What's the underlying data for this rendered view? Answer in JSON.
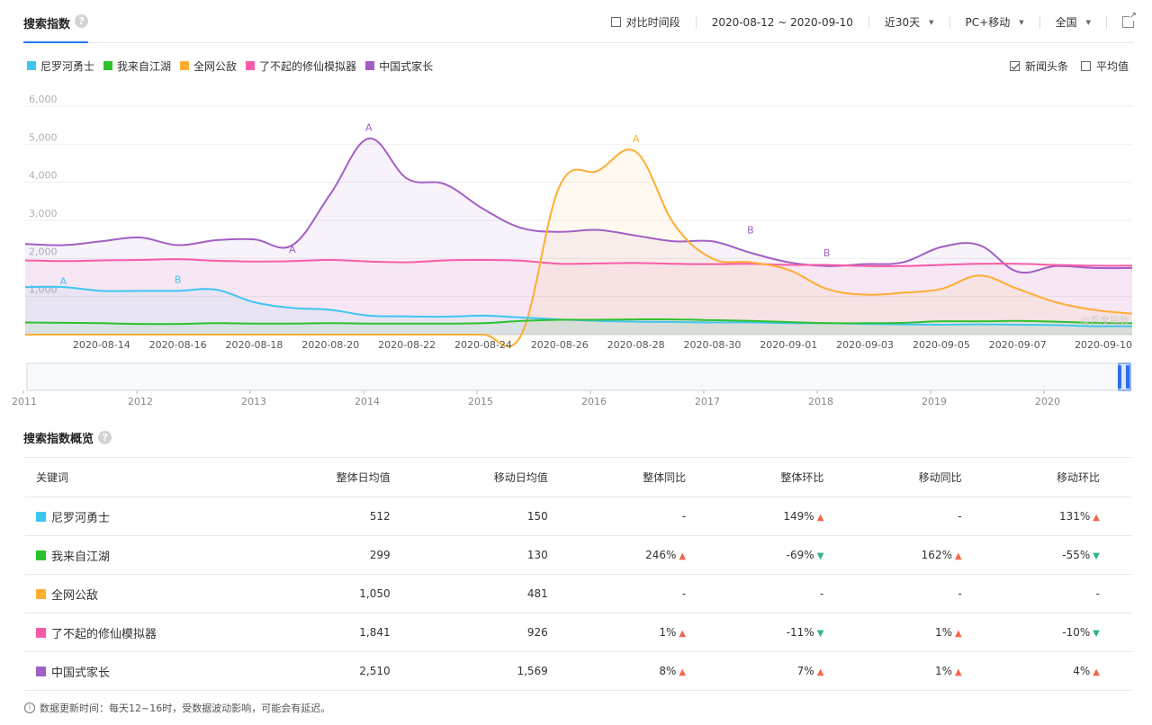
{
  "header": {
    "title": "搜索指数",
    "compare_label": "对比时间段",
    "date_range": "2020-08-12 ~ 2020-09-10",
    "period": "近30天",
    "device": "PC+移动",
    "region": "全国"
  },
  "legend_options": {
    "news_label": "新闻头条",
    "avg_label": "平均值"
  },
  "chart_data": {
    "type": "area",
    "ylim": [
      0,
      6000
    ],
    "yticks": [
      "6,000",
      "5,000",
      "4,000",
      "3,000",
      "2,000",
      "1,000"
    ],
    "x": [
      "2020-08-12",
      "2020-08-13",
      "2020-08-14",
      "2020-08-15",
      "2020-08-16",
      "2020-08-17",
      "2020-08-18",
      "2020-08-19",
      "2020-08-20",
      "2020-08-21",
      "2020-08-22",
      "2020-08-23",
      "2020-08-24",
      "2020-08-25",
      "2020-08-26",
      "2020-08-27",
      "2020-08-28",
      "2020-08-29",
      "2020-08-30",
      "2020-08-31",
      "2020-09-01",
      "2020-09-02",
      "2020-09-03",
      "2020-09-04",
      "2020-09-05",
      "2020-09-06",
      "2020-09-07",
      "2020-09-08",
      "2020-09-09",
      "2020-09-10"
    ],
    "xtick_labels": [
      "2020-08-14",
      "2020-08-16",
      "2020-08-18",
      "2020-08-20",
      "2020-08-22",
      "2020-08-24",
      "2020-08-26",
      "2020-08-28",
      "2020-08-30",
      "2020-09-01",
      "2020-09-03",
      "2020-09-05",
      "2020-09-07",
      "2020-09-10"
    ],
    "series": [
      {
        "name": "尼罗河勇士",
        "color": "#3ec6f2",
        "values": [
          1250,
          1250,
          1150,
          1150,
          1150,
          1180,
          850,
          700,
          650,
          500,
          480,
          470,
          500,
          450,
          400,
          360,
          340,
          330,
          320,
          320,
          300,
          300,
          280,
          270,
          260,
          270,
          260,
          250,
          220,
          220
        ]
      },
      {
        "name": "我来自江湖",
        "color": "#2ec12e",
        "values": [
          320,
          310,
          300,
          280,
          280,
          300,
          290,
          290,
          300,
          290,
          290,
          290,
          300,
          360,
          390,
          390,
          400,
          400,
          380,
          360,
          330,
          300,
          300,
          310,
          350,
          350,
          360,
          340,
          310,
          300
        ]
      },
      {
        "name": "全网公敌",
        "color": "#ffad33",
        "values": [
          0,
          0,
          0,
          0,
          0,
          0,
          0,
          0,
          0,
          0,
          0,
          0,
          0,
          0,
          3900,
          4300,
          4800,
          2900,
          2000,
          1900,
          1700,
          1200,
          1050,
          1100,
          1200,
          1550,
          1200,
          850,
          650,
          550
        ]
      },
      {
        "name": "了不起的修仙模拟器",
        "color": "#f85ba6",
        "values": [
          1950,
          1930,
          1950,
          1960,
          1980,
          1940,
          1920,
          1930,
          1960,
          1920,
          1900,
          1950,
          1960,
          1940,
          1860,
          1870,
          1880,
          1860,
          1850,
          1860,
          1830,
          1830,
          1800,
          1800,
          1830,
          1860,
          1860,
          1830,
          1810,
          1810
        ]
      },
      {
        "name": "中国式家长",
        "color": "#a25fc5",
        "values": [
          2380,
          2350,
          2450,
          2550,
          2350,
          2480,
          2500,
          2350,
          3700,
          5150,
          4100,
          3950,
          3300,
          2800,
          2700,
          2750,
          2600,
          2450,
          2450,
          2150,
          1900,
          1800,
          1850,
          1900,
          2300,
          2350,
          1650,
          1800,
          1750,
          1750
        ]
      }
    ],
    "markers": [
      {
        "label": "A",
        "series": "尼罗河勇士",
        "x": "2020-08-13",
        "value": 1400
      },
      {
        "label": "B",
        "series": "尼罗河勇士",
        "x": "2020-08-16",
        "value": 1450
      },
      {
        "label": "A",
        "series": "中国式家长",
        "x": "2020-08-19",
        "value": 2250
      },
      {
        "label": "A",
        "series": "中国式家长",
        "x": "2020-08-21",
        "value": 5450
      },
      {
        "label": "A",
        "series": "全网公敌",
        "x": "2020-08-28",
        "value": 5150
      },
      {
        "label": "B",
        "series": "中国式家长",
        "x": "2020-08-31",
        "value": 2750
      },
      {
        "label": "B",
        "series": "中国式家长",
        "x": "2020-09-02",
        "value": 2150
      }
    ],
    "watermark": "@百度指数"
  },
  "timeline": {
    "years": [
      "2011",
      "2012",
      "2013",
      "2014",
      "2015",
      "2016",
      "2017",
      "2018",
      "2019",
      "2020"
    ]
  },
  "overview": {
    "title": "搜索指数概览",
    "columns": [
      "关键词",
      "整体日均值",
      "移动日均值",
      "整体同比",
      "整体环比",
      "移动同比",
      "移动环比"
    ],
    "rows": [
      {
        "keyword": "尼罗河勇士",
        "color": "#3ec6f2",
        "overall_avg": "512",
        "mobile_avg": "150",
        "overall_yoy": "-",
        "overall_yoy_dir": "",
        "overall_mom": "149%",
        "overall_mom_dir": "up",
        "mobile_yoy": "-",
        "mobile_yoy_dir": "",
        "mobile_mom": "131%",
        "mobile_mom_dir": "up"
      },
      {
        "keyword": "我来自江湖",
        "color": "#2ec12e",
        "overall_avg": "299",
        "mobile_avg": "130",
        "overall_yoy": "246%",
        "overall_yoy_dir": "up",
        "overall_mom": "-69%",
        "overall_mom_dir": "down",
        "mobile_yoy": "162%",
        "mobile_yoy_dir": "up",
        "mobile_mom": "-55%",
        "mobile_mom_dir": "down"
      },
      {
        "keyword": "全网公敌",
        "color": "#ffad33",
        "overall_avg": "1,050",
        "mobile_avg": "481",
        "overall_yoy": "-",
        "overall_yoy_dir": "",
        "overall_mom": "-",
        "overall_mom_dir": "",
        "mobile_yoy": "-",
        "mobile_yoy_dir": "",
        "mobile_mom": "-",
        "mobile_mom_dir": ""
      },
      {
        "keyword": "了不起的修仙模拟器",
        "color": "#f85ba6",
        "overall_avg": "1,841",
        "mobile_avg": "926",
        "overall_yoy": "1%",
        "overall_yoy_dir": "up",
        "overall_mom": "-11%",
        "overall_mom_dir": "down",
        "mobile_yoy": "1%",
        "mobile_yoy_dir": "up",
        "mobile_mom": "-10%",
        "mobile_mom_dir": "down"
      },
      {
        "keyword": "中国式家长",
        "color": "#a25fc5",
        "overall_avg": "2,510",
        "mobile_avg": "1,569",
        "overall_yoy": "8%",
        "overall_yoy_dir": "up",
        "overall_mom": "7%",
        "overall_mom_dir": "up",
        "mobile_yoy": "1%",
        "mobile_yoy_dir": "up",
        "mobile_mom": "4%",
        "mobile_mom_dir": "up"
      }
    ]
  },
  "footnote": "数据更新时间：每天12~16时，受数据波动影响，可能会有延迟。"
}
